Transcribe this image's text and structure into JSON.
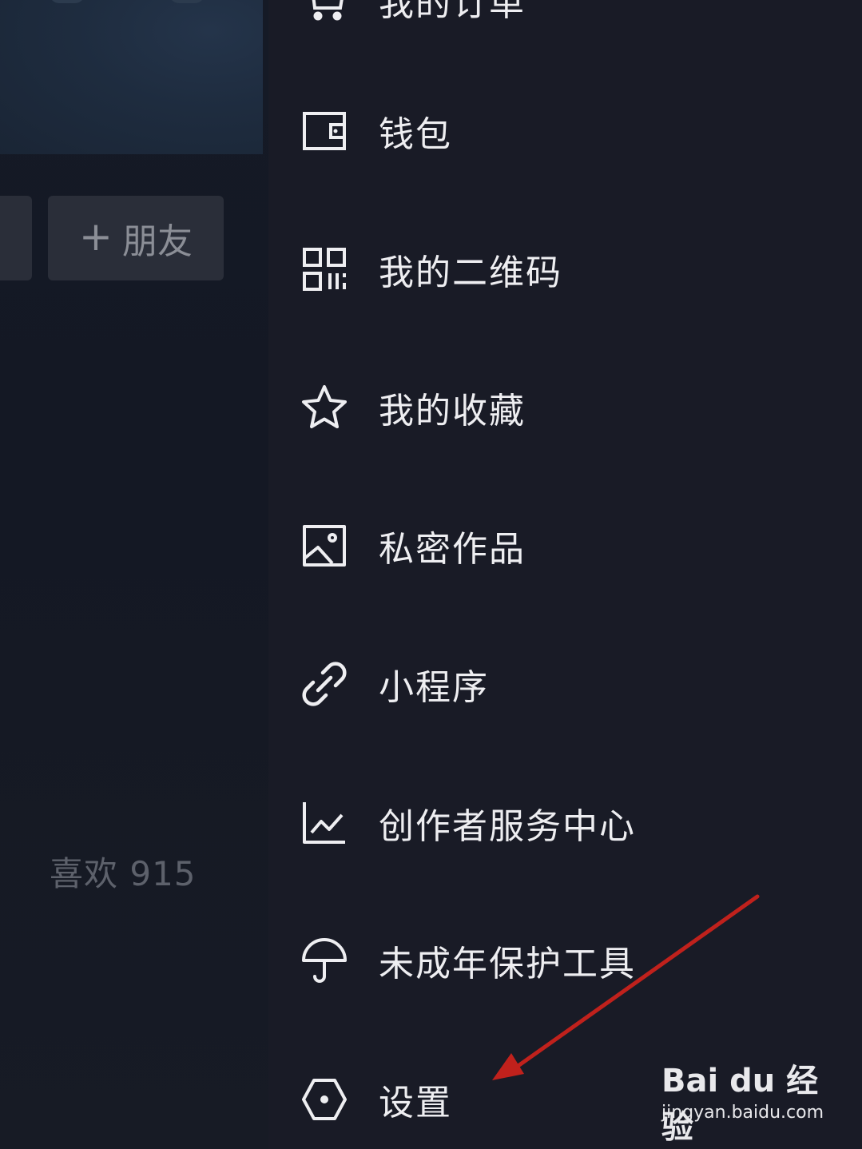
{
  "left": {
    "add_friend_label": "朋友",
    "add_friend_plus": "+",
    "likes_label": "喜欢 915"
  },
  "drawer": {
    "items": [
      {
        "label": "我的订单",
        "icon": "cart-icon"
      },
      {
        "label": "钱包",
        "icon": "wallet-icon"
      },
      {
        "label": "我的二维码",
        "icon": "qr-code-icon"
      },
      {
        "label": "我的收藏",
        "icon": "star-icon"
      },
      {
        "label": "私密作品",
        "icon": "image-icon"
      },
      {
        "label": "小程序",
        "icon": "link-icon"
      },
      {
        "label": "创作者服务中心",
        "icon": "chart-icon"
      },
      {
        "label": "未成年保护工具",
        "icon": "umbrella-icon"
      },
      {
        "label": "设置",
        "icon": "settings-hexagon-icon"
      }
    ]
  },
  "annotation": {
    "arrow_color": "#c0211c"
  },
  "watermark": {
    "brand": "Bai du 经验",
    "url": "jingyan.baidu.com"
  },
  "colors": {
    "background": "#191b26",
    "text": "#eeeef1"
  }
}
